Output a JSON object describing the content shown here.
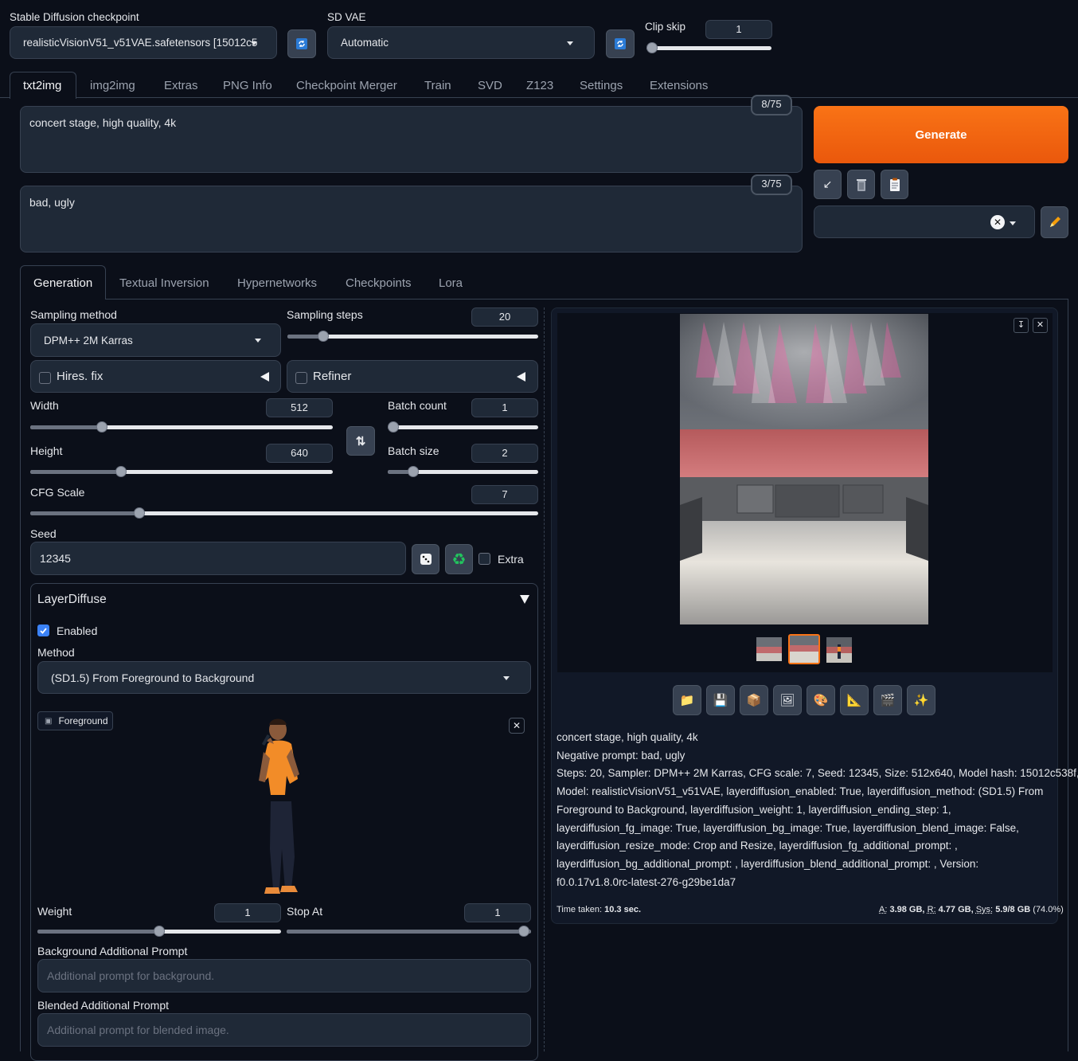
{
  "top": {
    "checkpoint_label": "Stable Diffusion checkpoint",
    "checkpoint_value": "realisticVisionV51_v51VAE.safetensors [15012c5",
    "vae_label": "SD VAE",
    "vae_value": "Automatic",
    "clip_skip_label": "Clip skip",
    "clip_skip_value": "1",
    "clip_skip_level": 0
  },
  "tabs": [
    "txt2img",
    "img2img",
    "Extras",
    "PNG Info",
    "Checkpoint Merger",
    "Train",
    "SVD",
    "Z123",
    "Settings",
    "Extensions"
  ],
  "prompt": {
    "positive": "concert stage, high quality, 4k",
    "positive_count": "8/75",
    "negative": "bad, ugly",
    "negative_count": "3/75"
  },
  "actions": {
    "generate": "Generate"
  },
  "subtabs": [
    "Generation",
    "Textual Inversion",
    "Hypernetworks",
    "Checkpoints",
    "Lora"
  ],
  "gen": {
    "sampling_method_label": "Sampling method",
    "sampling_method": "DPM++ 2M Karras",
    "sampling_steps_label": "Sampling steps",
    "sampling_steps": "20",
    "hires_label": "Hires. fix",
    "refiner_label": "Refiner",
    "width_label": "Width",
    "width": "512",
    "height_label": "Height",
    "height": "640",
    "batch_count_label": "Batch count",
    "batch_count": "1",
    "batch_size_label": "Batch size",
    "batch_size": "2",
    "cfg_label": "CFG Scale",
    "cfg": "7",
    "seed_label": "Seed",
    "seed": "12345",
    "extra_label": "Extra"
  },
  "layerdiffuse": {
    "title": "LayerDiffuse",
    "enabled_label": "Enabled",
    "enabled": true,
    "method_label": "Method",
    "method": "(SD1.5) From Foreground to Background",
    "foreground_label": "Foreground",
    "weight_label": "Weight",
    "weight": "1",
    "stop_at_label": "Stop At",
    "stop_at": "1",
    "bg_prompt_label": "Background Additional Prompt",
    "bg_prompt_placeholder": "Additional prompt for background.",
    "blend_prompt_label": "Blended Additional Prompt",
    "blend_prompt_placeholder": "Additional prompt for blended image."
  },
  "output": {
    "info_lines": [
      "concert stage, high quality, 4k",
      "Negative prompt: bad, ugly",
      "Steps: 20, Sampler: DPM++ 2M Karras, CFG scale: 7, Seed: 12345, Size: 512x640, Model hash: 15012c538f,",
      "Model: realisticVisionV51_v51VAE, layerdiffusion_enabled: True, layerdiffusion_method: (SD1.5) From",
      "Foreground to Background, layerdiffusion_weight: 1, layerdiffusion_ending_step: 1,",
      "layerdiffusion_fg_image: True, layerdiffusion_bg_image: True, layerdiffusion_blend_image: False,",
      "layerdiffusion_resize_mode: Crop and Resize, layerdiffusion_fg_additional_prompt: ,",
      "layerdiffusion_bg_additional_prompt: , layerdiffusion_blend_additional_prompt: , Version:",
      "f0.0.17v1.8.0rc-latest-276-g29be1da7"
    ],
    "time_label": "Time taken:",
    "time_value": "10.3 sec.",
    "a_label": "A:",
    "a_value": "3.98 GB,",
    "r_label": "R:",
    "r_value": "4.77 GB,",
    "sys_label": "Sys:",
    "sys_value": "5.9/8 GB",
    "sys_pct": "(74.0%)"
  },
  "colors": {
    "accent": "#f97316",
    "background": "#0b0f19",
    "panel": "#1f2937"
  }
}
